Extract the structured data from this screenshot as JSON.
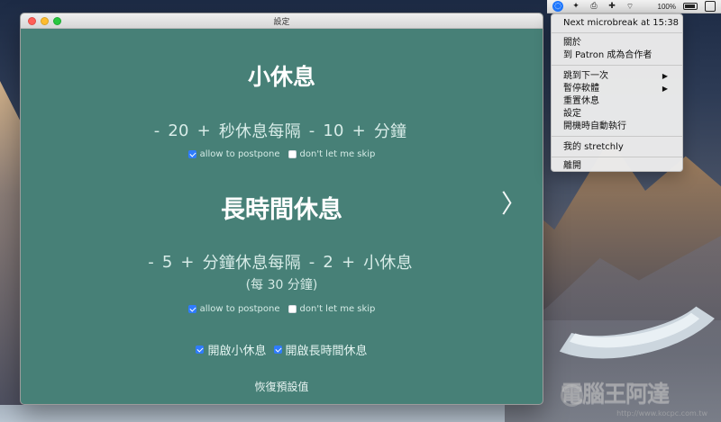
{
  "window": {
    "title": "設定",
    "traffic_lights": [
      "close",
      "minimize",
      "zoom"
    ]
  },
  "menubar": {
    "icons": [
      "stretchly-menu-icon",
      "magic-wand-icon",
      "printer-icon",
      "plus-icon",
      "wifi-icon"
    ],
    "battery_label": "100%"
  },
  "menu": {
    "items": [
      {
        "label": "Next microbreak at 15:38"
      },
      {
        "label": "關於"
      },
      {
        "label": "到 Patron 成為合作者"
      },
      {
        "label": "跳到下一次",
        "submenu": true
      },
      {
        "label": "暫停軟體",
        "submenu": true
      },
      {
        "label": "重置休息"
      },
      {
        "label": "設定"
      },
      {
        "label": "開機時自動執行"
      },
      {
        "label": "我的 stretchly"
      },
      {
        "label": "離開"
      }
    ]
  },
  "settings": {
    "micro": {
      "title": "小休息",
      "minus_1": "-",
      "value_1": "20",
      "plus_1": "+",
      "unit_1": "秒休息每隔",
      "minus_2": "-",
      "value_2": "10",
      "plus_2": "+",
      "unit_2": "分鐘",
      "allow_postpone": "allow to postpone",
      "skip": "don't let me skip",
      "allow_postpone_checked": true,
      "skip_checked": false
    },
    "long": {
      "title": "長時間休息",
      "minus_1": "-",
      "value_1": "5",
      "plus_1": "+",
      "unit_1": "分鐘休息每隔",
      "minus_2": "-",
      "value_2": "2",
      "plus_2": "+",
      "unit_2": "小休息",
      "subtext": "(每 30 分鐘)",
      "allow_postpone": "allow to postpone",
      "skip": "don't let me skip",
      "allow_postpone_checked": true,
      "skip_checked": false
    },
    "enable": {
      "mini_label": "開啟小休息",
      "long_label": "開啟長時間休息",
      "mini_checked": true,
      "long_checked": true
    },
    "restore_defaults": "恢復預設值",
    "next_arrow": "〉"
  },
  "watermark": {
    "text": "電腦王阿達",
    "url": "http://www.kocpc.com.tw"
  }
}
